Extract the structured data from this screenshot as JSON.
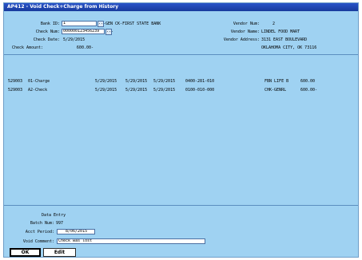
{
  "window": {
    "title": "AP412 - Void Check+Charge from History"
  },
  "header": {
    "bank_id_label": "Bank ID:",
    "bank_id_value": "1",
    "bank_name": "GEN CK-FIRST STATE BANK",
    "check_num_label": "Check Num:",
    "check_num_value": "000000123456239",
    "check_date_label": "Check Date:",
    "check_date_value": "5/29/2015",
    "check_amount_label": "Check Amount:",
    "check_amount_value": "600.00-",
    "lookup_glyph": "...",
    "vendor_num_label": "Vendor Num:",
    "vendor_num_value": "2",
    "vendor_name_label": "Vendor Name:",
    "vendor_name_value": "LINDEL FOOD MART",
    "vendor_address_label": "Vendor Address:",
    "vendor_address_line1": "3131 EAST BOULEVARD",
    "vendor_address_line2": "OKLAHOMA CITY, OK 73116"
  },
  "rows": [
    {
      "id": "529003",
      "type": "01-Charge",
      "date1": "5/29/2015",
      "date2": "5/29/2015",
      "date3": "5/29/2015",
      "account": "0400-281-010",
      "vendor": "FBN LIFE B",
      "amount": "600.00"
    },
    {
      "id": "529003",
      "type": "A2-Check",
      "date1": "5/29/2015",
      "date2": "5/29/2015",
      "date3": "5/29/2015",
      "account": "0100-010-000",
      "vendor": "CHK-GENRL",
      "amount": "600.00-"
    }
  ],
  "footer": {
    "data_entry_label": "Data Entry",
    "batch_num_label": "Batch Num:",
    "batch_num_value": "997",
    "acct_period_label": "Acct Period:",
    "acct_period_value": "8/06/2015",
    "void_comment_label": "Void Comment:",
    "void_comment_value": "Check was lost"
  },
  "buttons": {
    "ok_label": "OK",
    "edit_label": "Edit"
  }
}
